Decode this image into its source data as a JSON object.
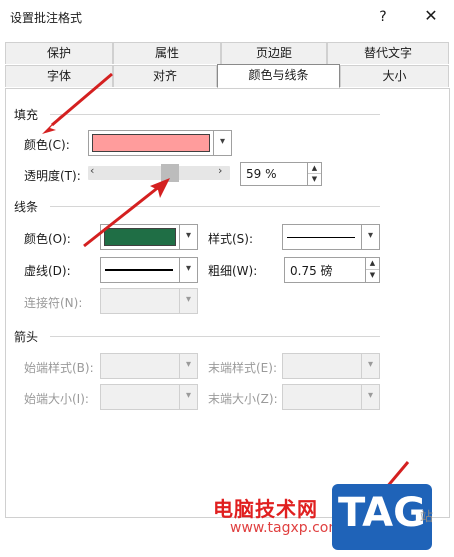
{
  "dialog": {
    "title": "设置批注格式",
    "help_glyph": "?",
    "close_glyph": "✕"
  },
  "tabs_row1": [
    "保护",
    "属性",
    "页边距",
    "替代文字"
  ],
  "tabs_row2": [
    "字体",
    "对齐",
    "颜色与线条",
    "大小"
  ],
  "active_tab": "颜色与线条",
  "fill": {
    "section": "填充",
    "color_label": "颜色(C):",
    "color_value": "#ff9c9c",
    "transparency_label": "透明度(T):",
    "transparency_value": "59 %",
    "transparency_fraction": 0.59
  },
  "line": {
    "section": "线条",
    "color_label": "颜色(O):",
    "color_value": "#1f6e45",
    "style_label": "样式(S):",
    "dash_label": "虚线(D):",
    "weight_label": "粗细(W):",
    "weight_value": "0.75 磅",
    "connector_label": "连接符(N):"
  },
  "arrows": {
    "section": "箭头",
    "begin_style_label": "始端样式(B):",
    "end_style_label": "末端样式(E):",
    "begin_size_label": "始端大小(I):",
    "end_size_label": "末端大小(Z):"
  },
  "watermark": {
    "site_name": "电脑技术网",
    "url": "www.tagxp.com",
    "logo": "TAG",
    "side_text": "站"
  },
  "colors": {
    "annotation_arrow": "#d42020",
    "accent": "#1f63b8"
  },
  "glyphs": {
    "dropdown": "▾",
    "spin_up": "▲",
    "spin_down": "▼",
    "slider_left": "‹",
    "slider_right": "›"
  }
}
